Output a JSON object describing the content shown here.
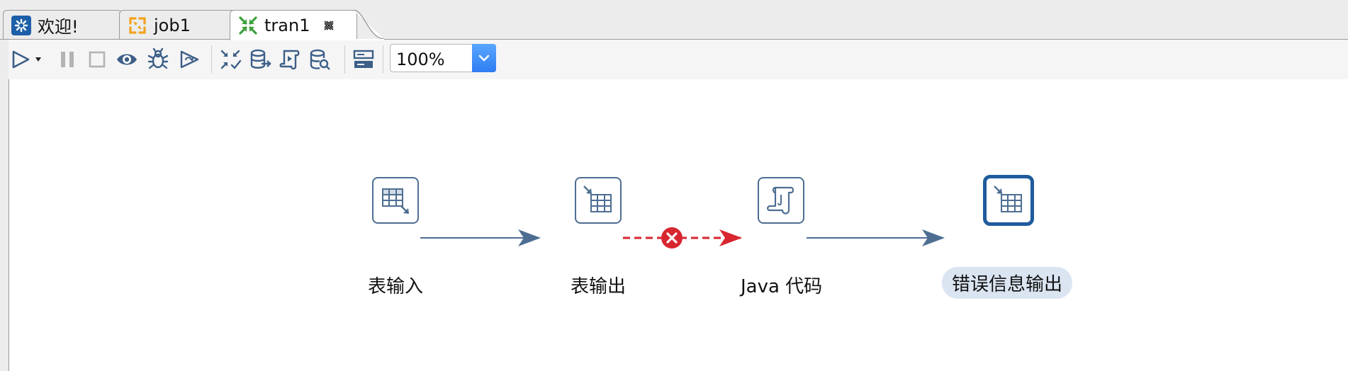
{
  "tabs": [
    {
      "label": "欢迎!",
      "icon": "welcome-icon"
    },
    {
      "label": "job1",
      "icon": "job-icon"
    },
    {
      "label": "tran1",
      "icon": "transformation-icon",
      "active": true
    }
  ],
  "toolbar": {
    "buttons": [
      "run-icon",
      "run-dropdown-icon",
      "pause-icon",
      "stop-icon",
      "preview-icon",
      "debug-icon",
      "replay-icon",
      "verify-icon",
      "impact-icon",
      "sql-icon",
      "explore-db-icon",
      "show-results-icon"
    ],
    "zoom": "100%"
  },
  "steps": [
    {
      "label": "表输入",
      "icon": "table-input-icon"
    },
    {
      "label": "表输出",
      "icon": "table-output-icon"
    },
    {
      "label": "Java 代码",
      "icon": "java-code-icon"
    },
    {
      "label": "错误信息输出",
      "icon": "table-output-icon",
      "selected": true
    }
  ],
  "hops": [
    {
      "from": "表输入",
      "to": "表输出",
      "type": "normal"
    },
    {
      "from": "表输出",
      "to": "Java 代码",
      "type": "error"
    },
    {
      "from": "Java 代码",
      "to": "错误信息输出",
      "type": "normal"
    }
  ],
  "colors": {
    "hop": "#4d6e92",
    "error_hop": "#d8262f",
    "selected_border": "#1f5c9e",
    "zoom_arrow": "#2f7df2"
  }
}
